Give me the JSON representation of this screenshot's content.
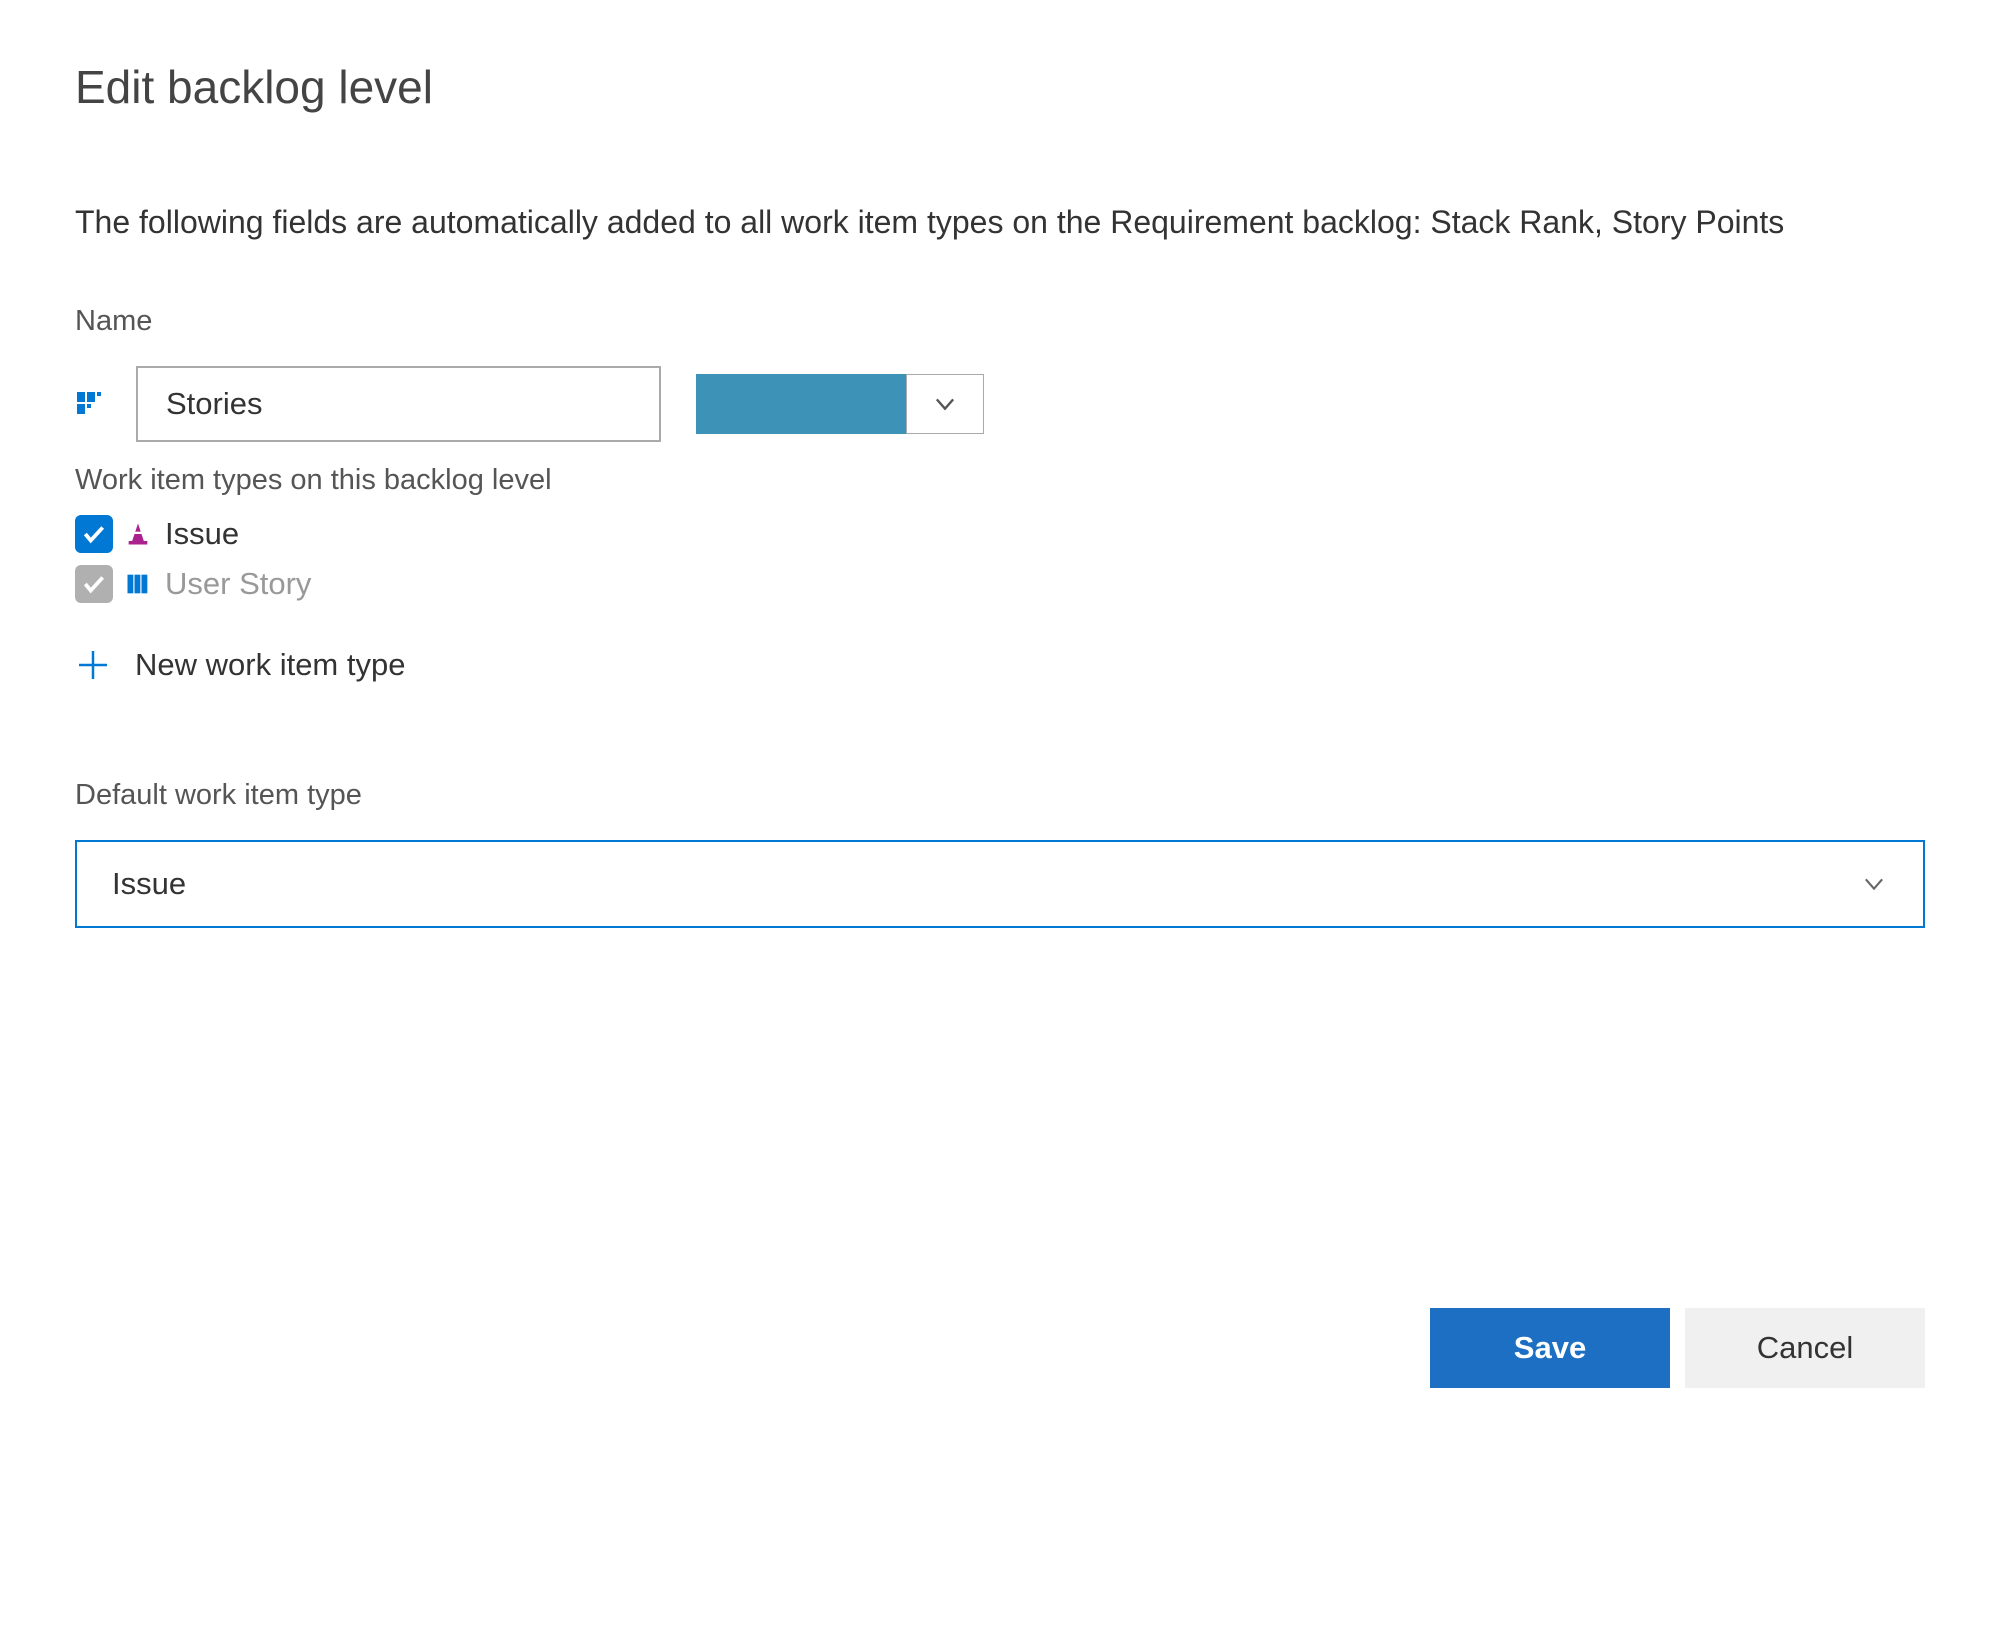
{
  "dialog": {
    "title": "Edit backlog level",
    "description": "The following fields are automatically added to all work item types on the Requirement backlog: Stack Rank, Story Points"
  },
  "name_field": {
    "label": "Name",
    "value": "Stories",
    "color": "#3d92b8"
  },
  "wit_section": {
    "label": "Work item types on this backlog level",
    "items": [
      {
        "name": "Issue",
        "checked": true,
        "enabled": true,
        "icon": "cone-icon",
        "icon_color": "#a9228e"
      },
      {
        "name": "User Story",
        "checked": true,
        "enabled": false,
        "icon": "book-icon",
        "icon_color": "#0078d4"
      }
    ],
    "new_button_label": "New work item type"
  },
  "default_section": {
    "label": "Default work item type",
    "selected": "Issue"
  },
  "buttons": {
    "save": "Save",
    "cancel": "Cancel"
  }
}
